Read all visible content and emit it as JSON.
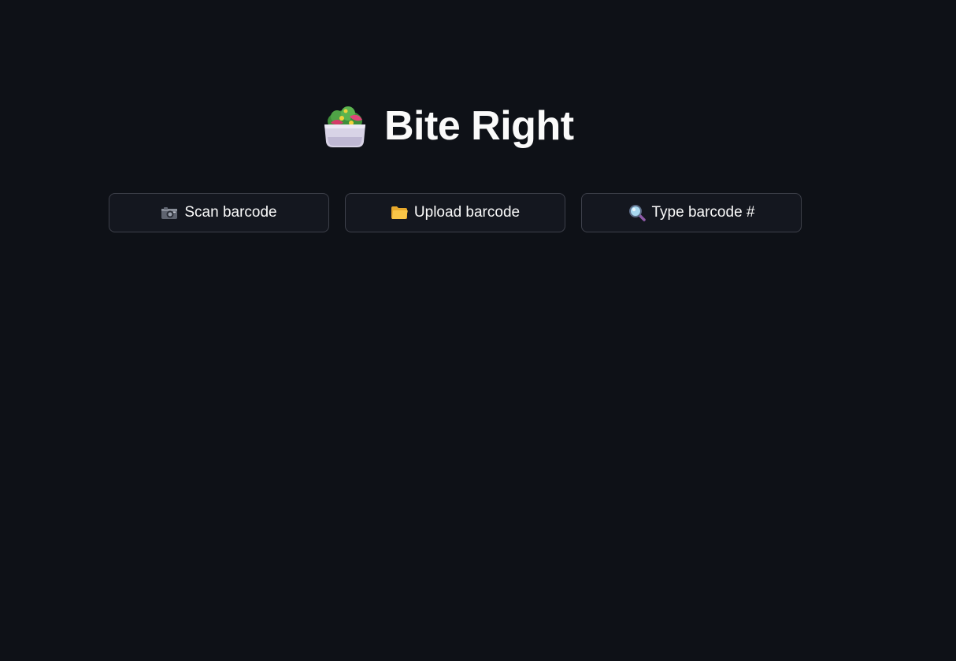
{
  "app": {
    "title": "Bite Right",
    "logo_icon": "salad-bowl-icon"
  },
  "actions": [
    {
      "label": "Scan barcode",
      "icon": "camera-icon"
    },
    {
      "label": "Upload barcode",
      "icon": "folder-icon"
    },
    {
      "label": "Type barcode #",
      "icon": "magnifier-icon"
    }
  ],
  "colors": {
    "background": "#0e1117",
    "button_background": "#14171f",
    "button_border": "#3d404a",
    "text": "#fafafa"
  }
}
